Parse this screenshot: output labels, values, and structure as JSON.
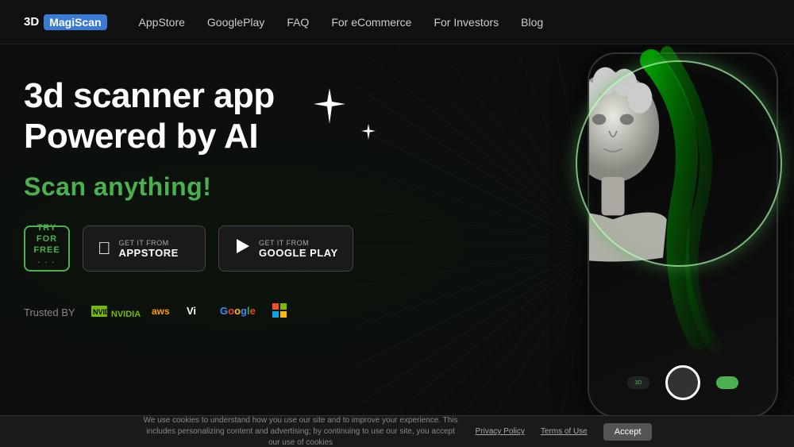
{
  "header": {
    "logo_prefix": "3D",
    "logo_name": "MagiScan",
    "nav": [
      {
        "label": "AppStore",
        "href": "#"
      },
      {
        "label": "GooglePlay",
        "href": "#"
      },
      {
        "label": "FAQ",
        "href": "#"
      },
      {
        "label": "For eCommerce",
        "href": "#"
      },
      {
        "label": "For Investors",
        "href": "#"
      },
      {
        "label": "Blog",
        "href": "#"
      }
    ]
  },
  "hero": {
    "title_line1": "3d scanner app",
    "title_line2": "Powered by AI",
    "subtitle": "Scan anything!",
    "try_btn": {
      "line1": "TRY",
      "line2": "FOR",
      "line3": "FREE",
      "dots": "· · · · ·"
    },
    "appstore_btn": {
      "get_it": "GET IT FROM",
      "store_name": "APPSTORE"
    },
    "googleplay_btn": {
      "get_it": "GET IT FROM",
      "store_name": "GOOGLE PLAY"
    }
  },
  "trusted": {
    "label": "Trusted BY",
    "logos": [
      {
        "name": "NVIDIA",
        "class": "nvidia"
      },
      {
        "name": "aws",
        "class": "aws"
      },
      {
        "name": "Vi",
        "class": "vi"
      },
      {
        "name": "Google",
        "class": "google"
      },
      {
        "name": "⊞",
        "class": "ms"
      }
    ]
  },
  "cookie": {
    "text": "We use cookies to understand how you use our site and to improve your experience. This includes personalizing content and advertising; by continuing to use our site, you accept our use of cookies",
    "privacy_link": "Privacy Policy",
    "terms_link": "Terms of Use",
    "accept_btn": "Accept"
  }
}
